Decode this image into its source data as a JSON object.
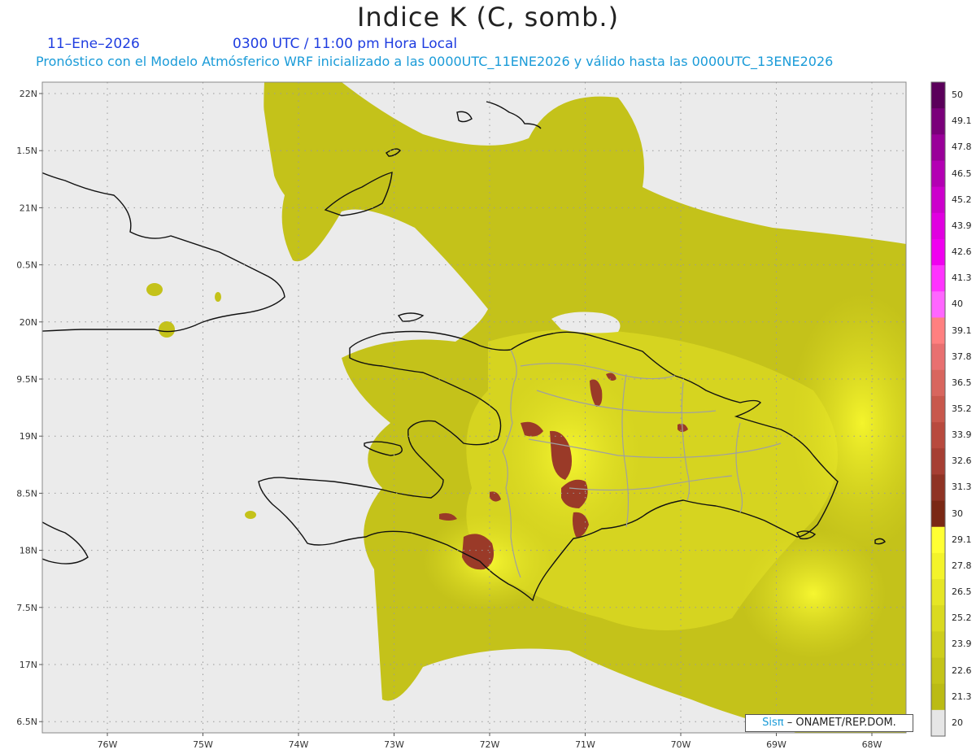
{
  "header": {
    "title": "Indice K (C, somb.)",
    "date": "11–Ene–2026",
    "time": "0300 UTC / 11:00 pm Hora Local",
    "subtitle": "Pronóstico con el Modelo Atmósferico WRF inicializado a las 0000UTC_11ENE2026 y válido hasta las  0000UTC_13ENE2026"
  },
  "map": {
    "lon_ticks": [
      "76W",
      "75W",
      "74W",
      "73W",
      "72W",
      "71W",
      "70W",
      "69W",
      "68W"
    ],
    "lat_ticks": [
      "22N",
      "1.5N",
      "21N",
      "0.5N",
      "20N",
      "9.5N",
      "19N",
      "8.5N",
      "18N",
      "7.5N",
      "17N",
      "6.5N"
    ],
    "background_color": "#ebebeb",
    "grid": true
  },
  "colorbar": {
    "labels": [
      "50",
      "49.1",
      "47.8",
      "46.5",
      "45.2",
      "43.9",
      "42.6",
      "41.3",
      "40",
      "39.1",
      "37.8",
      "36.5",
      "35.2",
      "33.9",
      "32.6",
      "31.3",
      "30",
      "29.1",
      "27.8",
      "26.5",
      "25.2",
      "23.9",
      "22.6",
      "21.3",
      "20"
    ],
    "colors": [
      "#5a005a",
      "#7a007a",
      "#990099",
      "#b300b3",
      "#cc00cc",
      "#e000e0",
      "#f000f0",
      "#ff33ff",
      "#ff66ff",
      "#ff8080",
      "#e87070",
      "#d8665e",
      "#c8584c",
      "#b84a3e",
      "#a63f33",
      "#8f3324",
      "#7a2814",
      "#ffff33",
      "#f3f32a",
      "#e6e625",
      "#dada20",
      "#cece1c",
      "#c4c418",
      "#bbbb14",
      "#e6e6e6"
    ]
  },
  "credit": {
    "sis": "Sisπ",
    "org": "– ONAMET/REP.DOM."
  },
  "colors": {
    "field_low": "#c4c21a",
    "field_mid": "#dcdc22",
    "field_high": "#f2f22a",
    "storm": "#9a3a28",
    "coast": "#111111",
    "border": "#a0a0a0"
  }
}
